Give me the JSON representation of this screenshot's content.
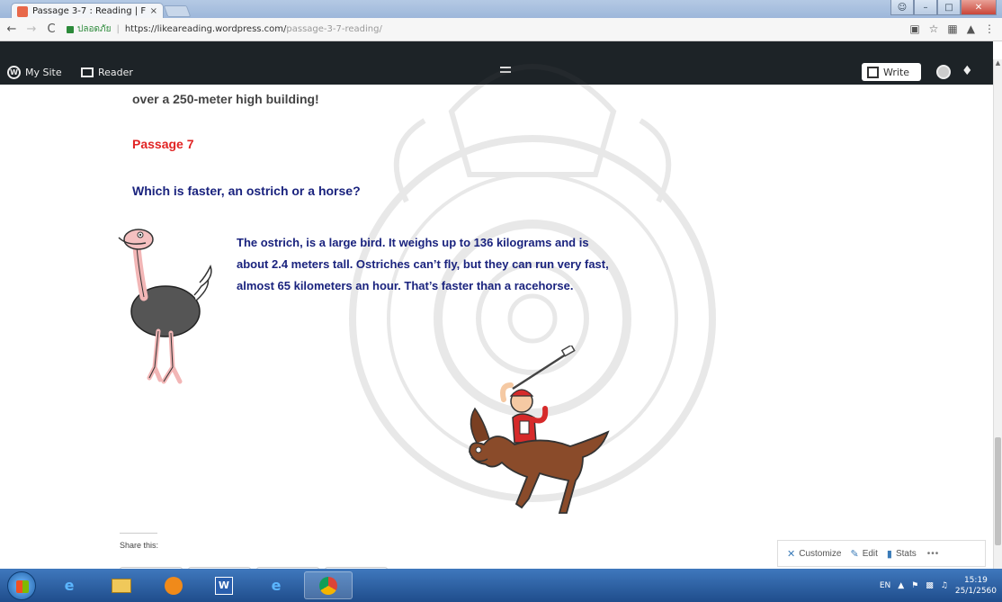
{
  "browser": {
    "tab_title": "Passage 3-7 : Reading | F",
    "tab_close": "×",
    "security_label": "ปลอดภัย",
    "url_host": "https://likeareading.wordpress.com/",
    "url_path": "passage-3-7-reading/",
    "nav_back": "←",
    "nav_forward": "→",
    "nav_reload": "C"
  },
  "wp_admin_bar": {
    "my_site": "My Site",
    "reader": "Reader",
    "write": "Write"
  },
  "article": {
    "prev_text": "over a 250-meter high building!",
    "passage_heading": "Passage 7",
    "question": "Which is faster, an ostrich or a horse?",
    "body": "The ostrich, is a large bird. It weighs up to 136 kilograms and is about 2.4 meters tall. Ostriches can’t fly, but they can run very fast, almost 65 kilometers an hour. That’s faster than a racehorse."
  },
  "share": {
    "label": "Share this:"
  },
  "customizer": {
    "customize": "Customize",
    "edit": "Edit",
    "stats": "Stats",
    "more": "•••"
  },
  "taskbar": {
    "lang": "EN",
    "time": "15:19",
    "date": "25/1/2560"
  },
  "colors": {
    "heading_red": "#e12323",
    "body_navy": "#1a237e",
    "admin_bar": "#1d2327"
  }
}
